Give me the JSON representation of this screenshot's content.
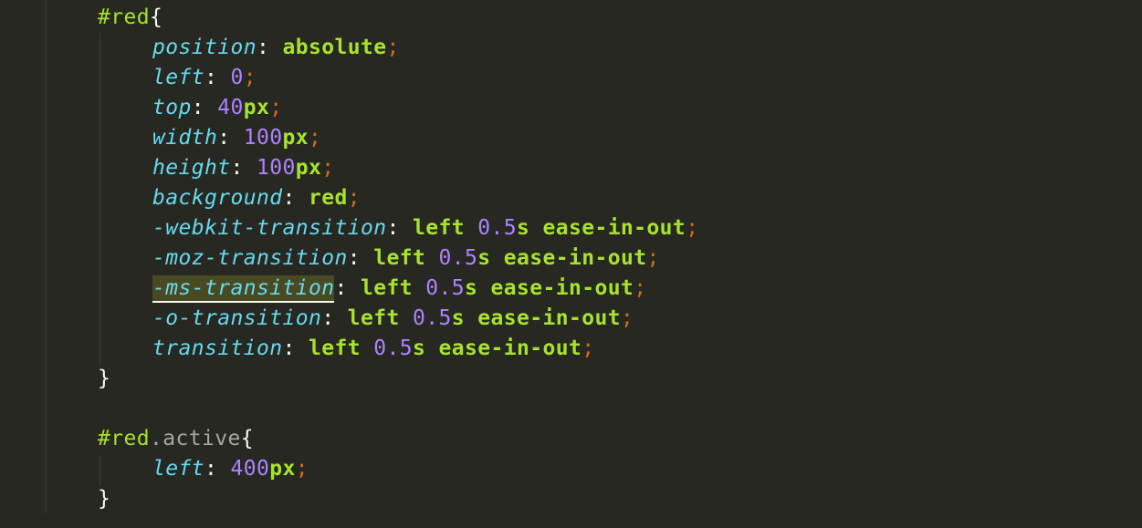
{
  "rules": [
    {
      "selector_id": "#red",
      "selector_class": "",
      "declarations": [
        {
          "prop": "position",
          "parts": [
            {
              "t": "val",
              "v": "absolute"
            }
          ]
        },
        {
          "prop": "left",
          "parts": [
            {
              "t": "num",
              "v": "0"
            }
          ]
        },
        {
          "prop": "top",
          "parts": [
            {
              "t": "num",
              "v": "40"
            },
            {
              "t": "unit",
              "v": "px"
            }
          ]
        },
        {
          "prop": "width",
          "parts": [
            {
              "t": "num",
              "v": "100"
            },
            {
              "t": "unit",
              "v": "px"
            }
          ]
        },
        {
          "prop": "height",
          "parts": [
            {
              "t": "num",
              "v": "100"
            },
            {
              "t": "unit",
              "v": "px"
            }
          ]
        },
        {
          "prop": "background",
          "parts": [
            {
              "t": "val",
              "v": "red"
            }
          ]
        },
        {
          "prop": "-webkit-transition",
          "parts": [
            {
              "t": "val",
              "v": "left"
            },
            {
              "t": "sp",
              "v": " "
            },
            {
              "t": "num",
              "v": "0.5"
            },
            {
              "t": "unit",
              "v": "s"
            },
            {
              "t": "sp",
              "v": " "
            },
            {
              "t": "val",
              "v": "ease-in-out"
            }
          ]
        },
        {
          "prop": "-moz-transition",
          "parts": [
            {
              "t": "val",
              "v": "left"
            },
            {
              "t": "sp",
              "v": " "
            },
            {
              "t": "num",
              "v": "0.5"
            },
            {
              "t": "unit",
              "v": "s"
            },
            {
              "t": "sp",
              "v": " "
            },
            {
              "t": "val",
              "v": "ease-in-out"
            }
          ]
        },
        {
          "prop": "-ms-transition",
          "highlight": true,
          "parts": [
            {
              "t": "val",
              "v": "left"
            },
            {
              "t": "sp",
              "v": " "
            },
            {
              "t": "num",
              "v": "0.5"
            },
            {
              "t": "unit",
              "v": "s"
            },
            {
              "t": "sp",
              "v": " "
            },
            {
              "t": "val",
              "v": "ease-in-out"
            }
          ]
        },
        {
          "prop": "-o-transition",
          "parts": [
            {
              "t": "val",
              "v": "left"
            },
            {
              "t": "sp",
              "v": " "
            },
            {
              "t": "num",
              "v": "0.5"
            },
            {
              "t": "unit",
              "v": "s"
            },
            {
              "t": "sp",
              "v": " "
            },
            {
              "t": "val",
              "v": "ease-in-out"
            }
          ]
        },
        {
          "prop": "transition",
          "parts": [
            {
              "t": "val",
              "v": "left"
            },
            {
              "t": "sp",
              "v": " "
            },
            {
              "t": "num",
              "v": "0.5"
            },
            {
              "t": "unit",
              "v": "s"
            },
            {
              "t": "sp",
              "v": " "
            },
            {
              "t": "val",
              "v": "ease-in-out"
            }
          ]
        }
      ]
    },
    {
      "selector_id": "#red",
      "selector_class": ".active",
      "declarations": [
        {
          "prop": "left",
          "parts": [
            {
              "t": "num",
              "v": "400"
            },
            {
              "t": "unit",
              "v": "px"
            }
          ]
        }
      ]
    }
  ],
  "punct": {
    "open": "{",
    "close": "}",
    "colon": ":",
    "semi": ";"
  },
  "colors": {
    "background": "#272822",
    "selector": "#a6e22e",
    "property": "#66d9ef",
    "number": "#ae81ff",
    "semicolon": "#d2691e"
  }
}
